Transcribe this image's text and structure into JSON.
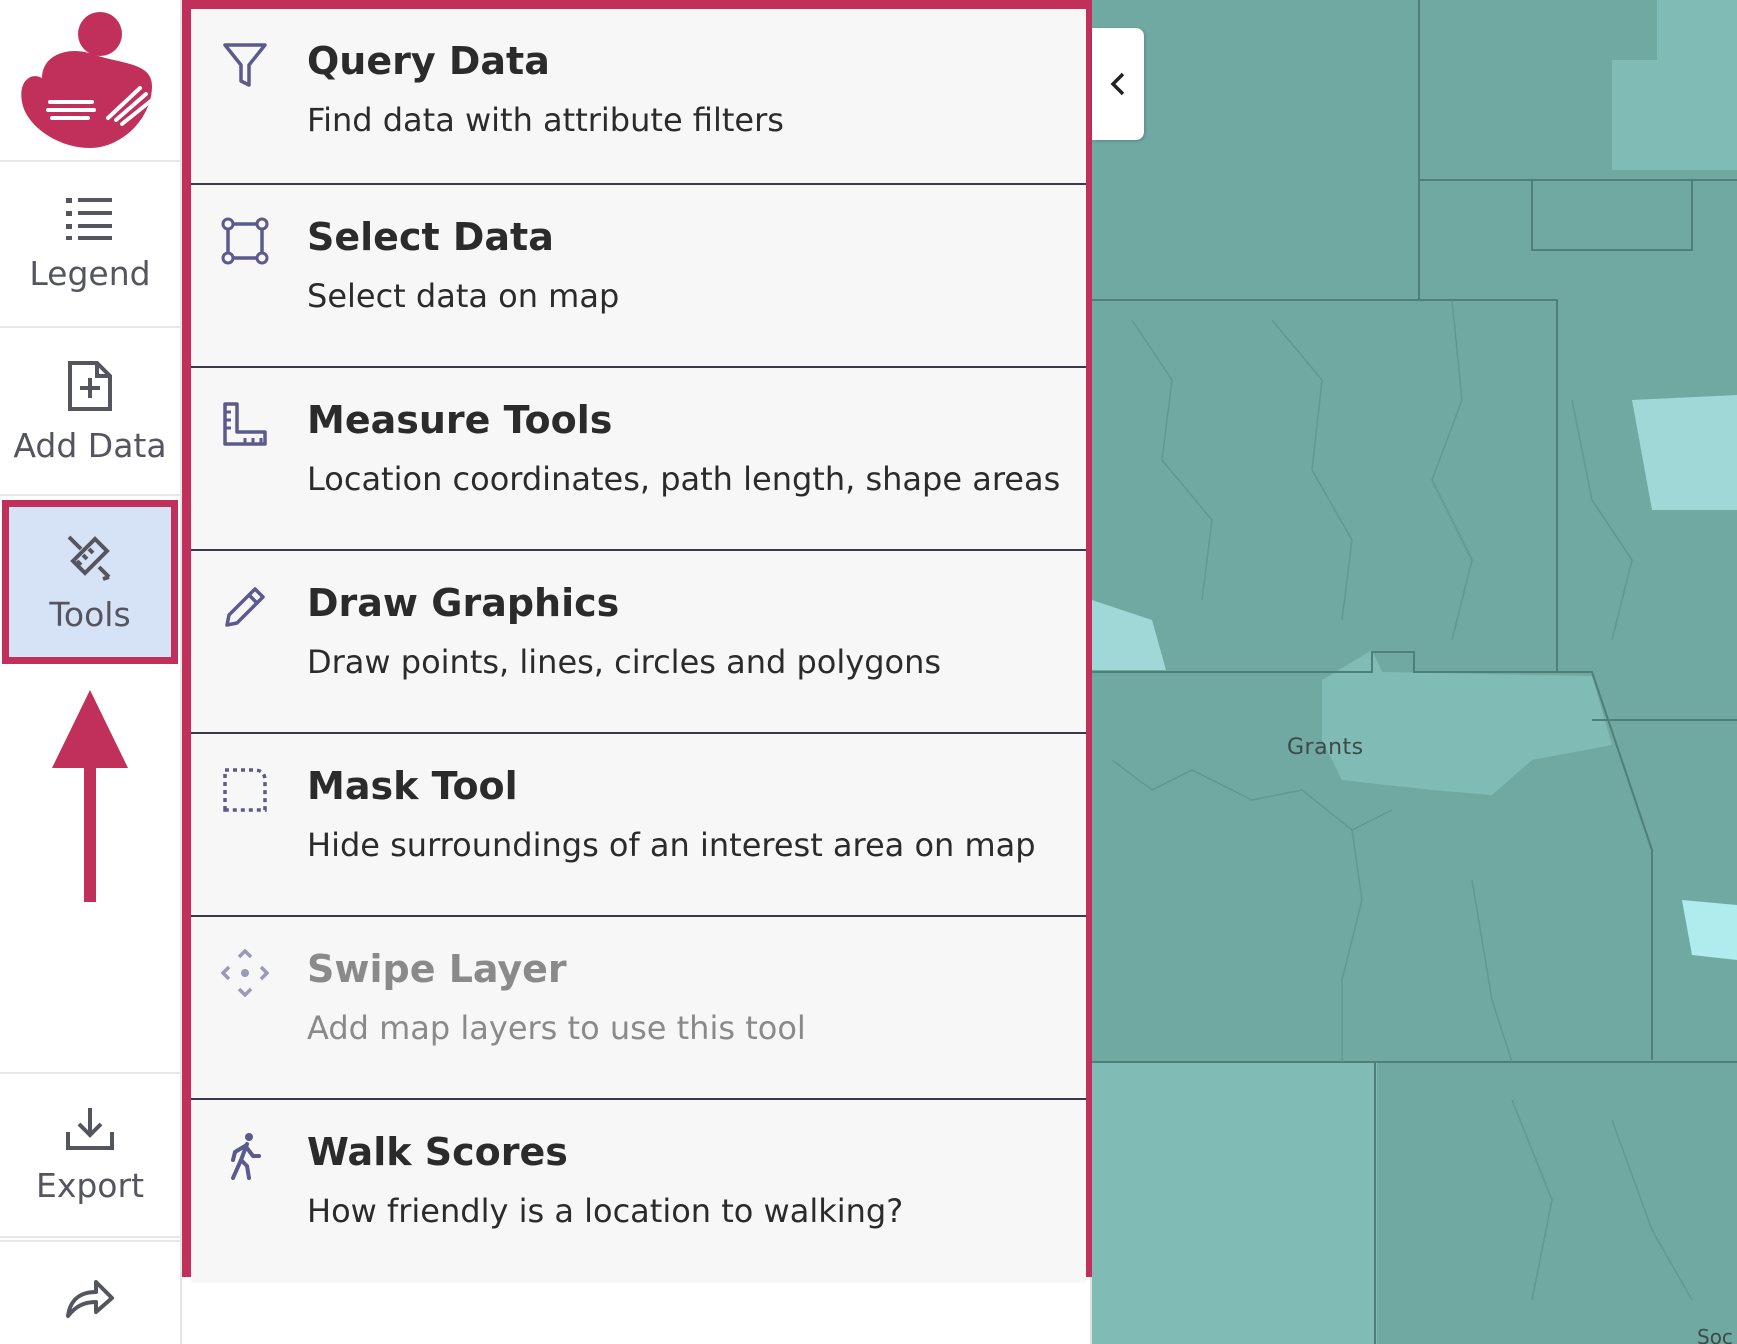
{
  "sidebar": {
    "items": [
      {
        "label": "Legend"
      },
      {
        "label": "Add Data"
      },
      {
        "label": "Tools"
      },
      {
        "label": "Export"
      }
    ]
  },
  "tools": [
    {
      "title": "Query Data",
      "description": "Find data with attribute filters",
      "icon": "filter-icon",
      "enabled": true
    },
    {
      "title": "Select Data",
      "description": "Select data on map",
      "icon": "select-box-icon",
      "enabled": true
    },
    {
      "title": "Measure Tools",
      "description": "Location coordinates, path length, shape areas",
      "icon": "ruler-icon",
      "enabled": true
    },
    {
      "title": "Draw Graphics",
      "description": "Draw points, lines, circles and polygons",
      "icon": "pencil-icon",
      "enabled": true
    },
    {
      "title": "Mask Tool",
      "description": "Hide surroundings of an interest area on map",
      "icon": "mask-icon",
      "enabled": true
    },
    {
      "title": "Swipe Layer",
      "description": "Add map layers to use this tool",
      "icon": "swipe-icon",
      "enabled": false
    },
    {
      "title": "Walk Scores",
      "description": "How friendly is a location to walking?",
      "icon": "walking-icon",
      "enabled": true
    }
  ],
  "map": {
    "city_label": "Grants",
    "corner_label": "Soc"
  },
  "colors": {
    "accent": "#c0305a",
    "active_bg": "#d6e3f7",
    "icon": "#5b5a8c",
    "map_base": "#6fa9a2",
    "map_light": "#80bcb5",
    "map_lighter": "#9fd8d6"
  }
}
